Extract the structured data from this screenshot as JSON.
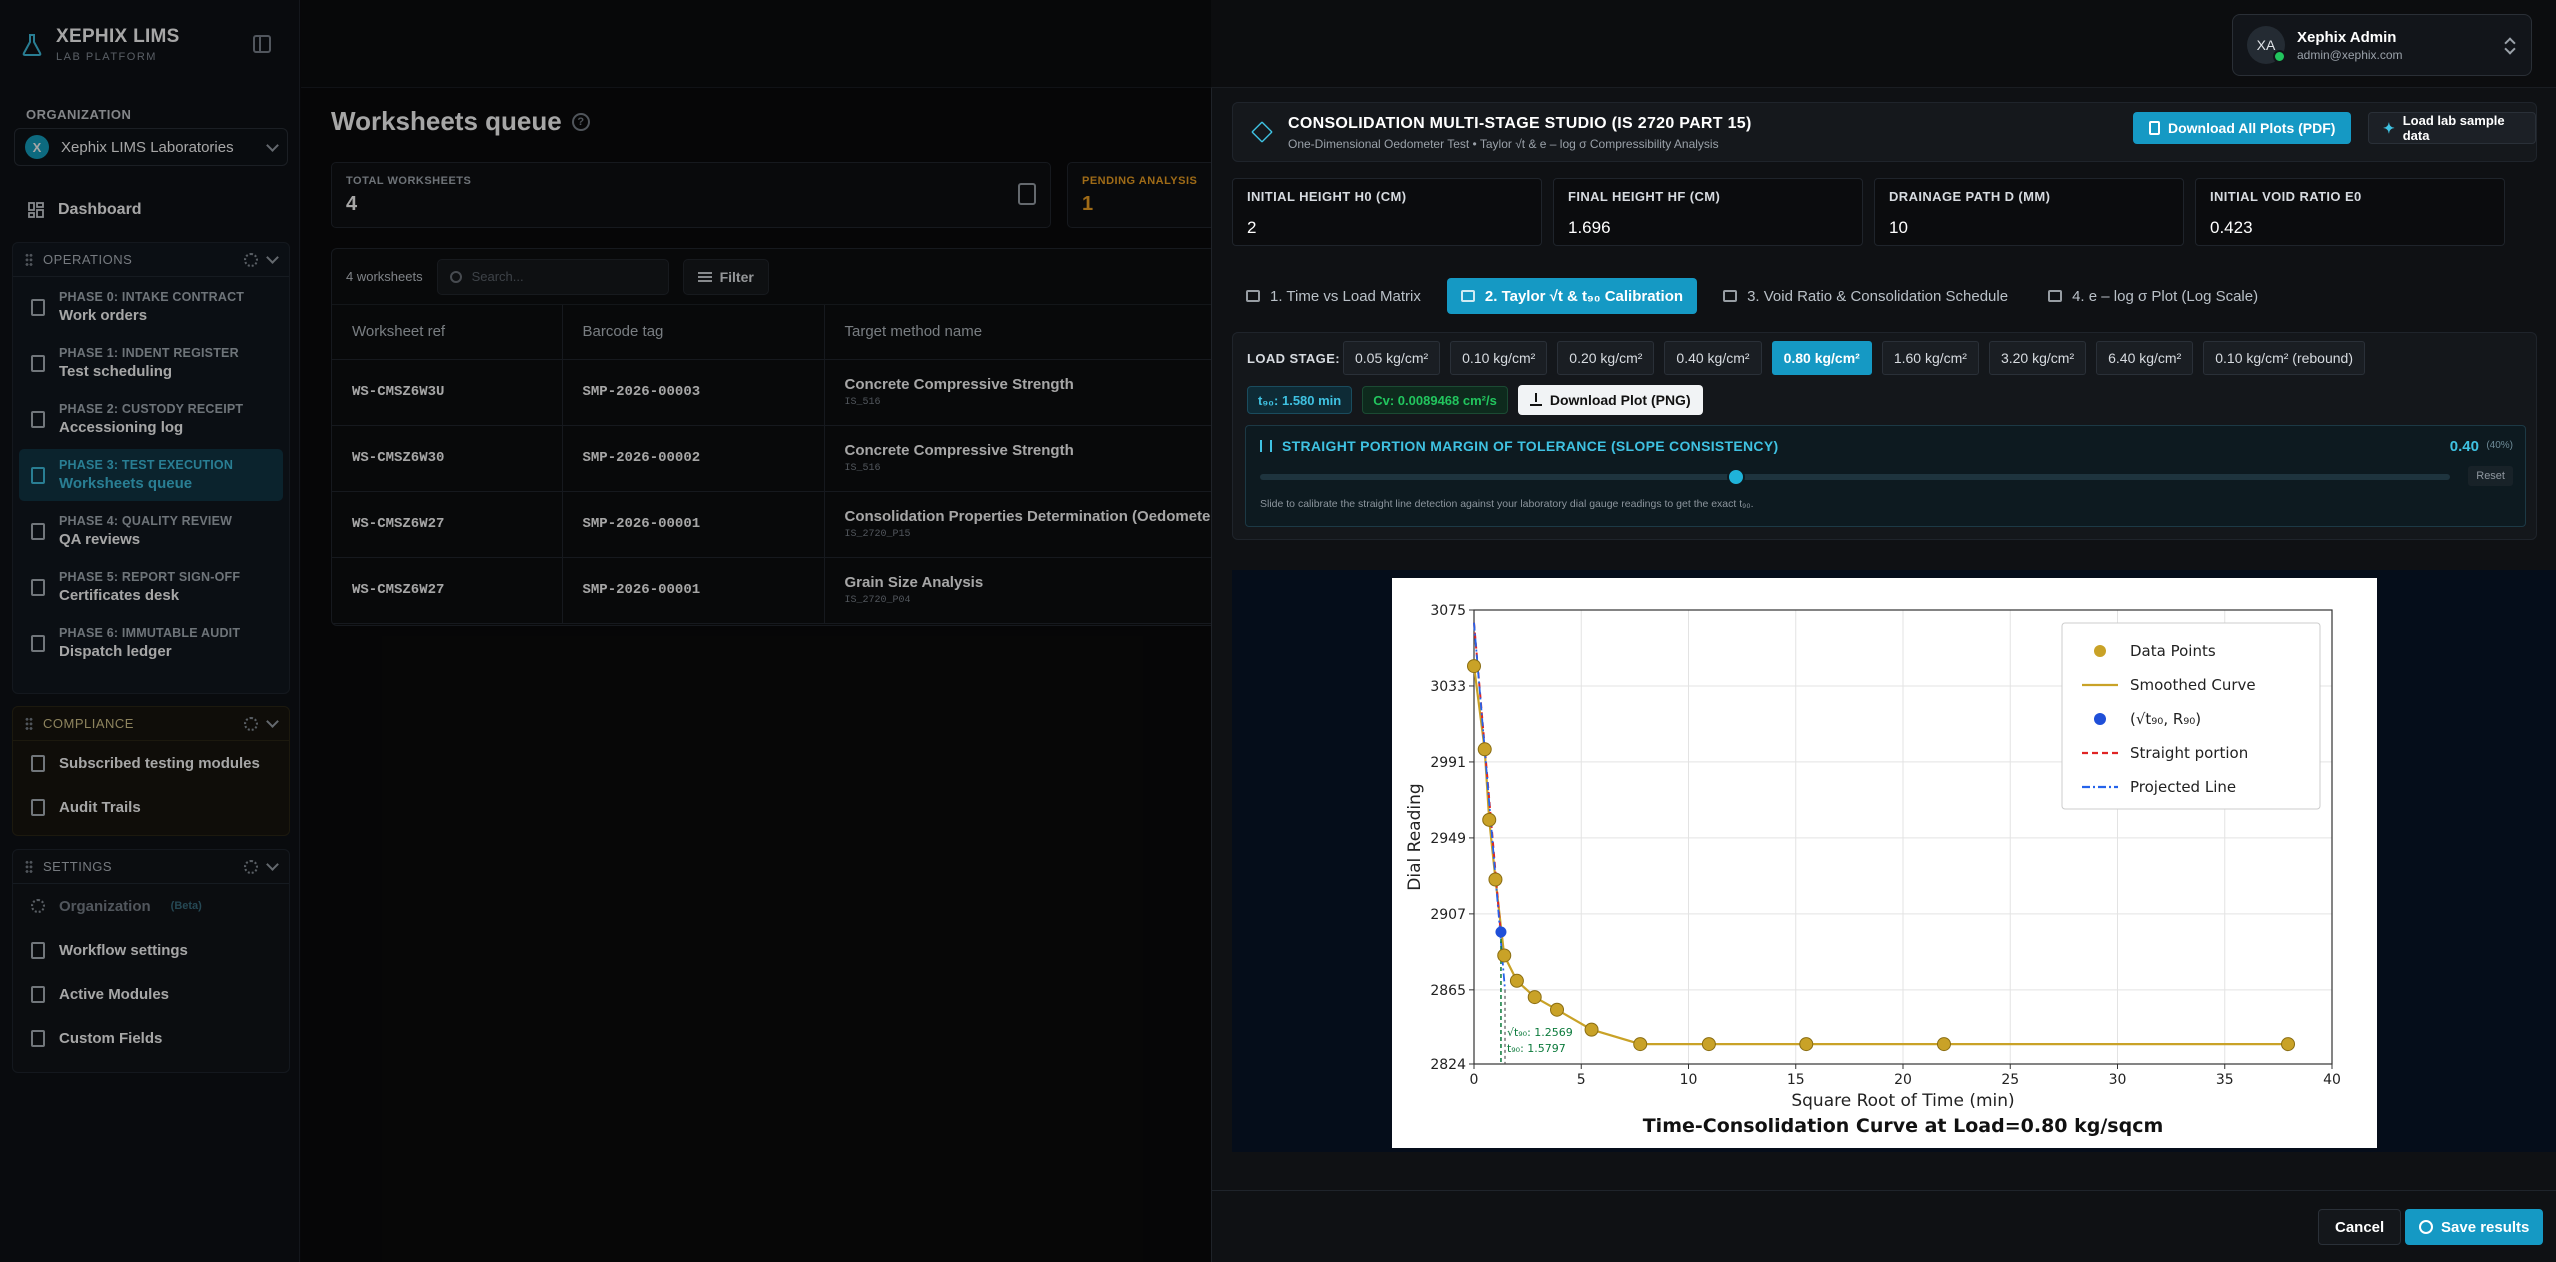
{
  "brand": {
    "title": "XEPHIX LIMS",
    "subtitle": "LAB PLATFORM"
  },
  "org": {
    "label": "ORGANIZATION",
    "badge": "X",
    "name": "Xephix LIMS Laboratories"
  },
  "nav": {
    "dashboard": "Dashboard",
    "operations": {
      "title": "OPERATIONS",
      "phases": [
        {
          "t1": "PHASE 0: INTAKE CONTRACT",
          "t2": "Work orders"
        },
        {
          "t1": "PHASE 1: INDENT REGISTER",
          "t2": "Test scheduling"
        },
        {
          "t1": "PHASE 2: CUSTODY RECEIPT",
          "t2": "Accessioning log"
        },
        {
          "t1": "PHASE 3: TEST EXECUTION",
          "t2": "Worksheets queue"
        },
        {
          "t1": "PHASE 4: QUALITY REVIEW",
          "t2": "QA reviews"
        },
        {
          "t1": "PHASE 5: REPORT SIGN-OFF",
          "t2": "Certificates desk"
        },
        {
          "t1": "PHASE 6: IMMUTABLE AUDIT",
          "t2": "Dispatch ledger"
        }
      ]
    },
    "compliance": {
      "title": "COMPLIANCE",
      "items": [
        "Subscribed testing modules",
        "Audit Trails"
      ]
    },
    "settings": {
      "title": "SETTINGS",
      "items": [
        "Organization",
        "Workflow settings",
        "Active Modules",
        "Custom Fields"
      ],
      "beta": "(Beta)"
    }
  },
  "user": {
    "initials": "XA",
    "name": "Xephix Admin",
    "email": "admin@xephix.com"
  },
  "page": {
    "title": "Worksheets queue",
    "help": "?"
  },
  "stats": [
    {
      "label": "TOTAL WORKSHEETS",
      "value": "4"
    },
    {
      "label": "PENDING ANALYSIS",
      "value": "1"
    }
  ],
  "table": {
    "count": "4 worksheets",
    "search_placeholder": "Search...",
    "filter": "Filter",
    "headers": [
      "Worksheet ref",
      "Barcode tag",
      "Target method name"
    ],
    "rows": [
      {
        "ref": "WS-CMSZ6W3U",
        "barcode": "SMP-2026-00003",
        "method": "Concrete Compressive Strength",
        "code": "IS_516"
      },
      {
        "ref": "WS-CMSZ6W30",
        "barcode": "SMP-2026-00002",
        "method": "Concrete Compressive Strength",
        "code": "IS_516"
      },
      {
        "ref": "WS-CMSZ6W27",
        "barcode": "SMP-2026-00001",
        "method": "Consolidation Properties Determination (Oedometer",
        "code": "IS_2720_P15"
      },
      {
        "ref": "WS-CMSZ6W27",
        "barcode": "SMP-2026-00001",
        "method": "Grain Size Analysis",
        "code": "IS_2720_P04"
      }
    ]
  },
  "studio": {
    "title": "CONSOLIDATION MULTI-STAGE STUDIO (IS 2720 PART 15)",
    "subtitle": "One-Dimensional Oedometer Test • Taylor √t & e – log σ Compressibility Analysis",
    "download_all": "Download All Plots (PDF)",
    "load_sample": "Load lab sample data",
    "inputs": [
      {
        "label": "INITIAL HEIGHT H0 (CM)",
        "value": "2"
      },
      {
        "label": "FINAL HEIGHT HF (CM)",
        "value": "1.696"
      },
      {
        "label": "DRAINAGE PATH D (MM)",
        "value": "10"
      },
      {
        "label": "INITIAL VOID RATIO E0",
        "value": "0.423"
      }
    ],
    "tabs": [
      "1. Time vs Load Matrix",
      "2. Taylor √t & t₉₀ Calibration",
      "3. Void Ratio & Consolidation Schedule",
      "4. e – log σ Plot (Log Scale)"
    ],
    "load_stage_label": "LOAD STAGE:",
    "load_stages": [
      "0.05 kg/cm²",
      "0.10 kg/cm²",
      "0.20 kg/cm²",
      "0.40 kg/cm²",
      "0.80 kg/cm²",
      "1.60 kg/cm²",
      "3.20 kg/cm²",
      "6.40 kg/cm²",
      "0.10 kg/cm² (rebound)"
    ],
    "t90": "t₉₀: 1.580 min",
    "cv": "Cv: 0.0089468 cm²/s",
    "download_png": "Download Plot (PNG)",
    "tolerance": {
      "title": "STRAIGHT PORTION MARGIN OF TOLERANCE (SLOPE CONSISTENCY)",
      "value": "0.40",
      "pct": "(40%)",
      "reset": "Reset",
      "level": 0.4,
      "help": "Slide to calibrate the straight line detection against your laboratory dial gauge readings to get the exact t₉₀."
    },
    "cancel": "Cancel",
    "save": "Save results"
  },
  "chart_data": {
    "type": "line",
    "title": "Time-Consolidation Curve at Load=0.80 kg/sqcm",
    "xlabel": "Square Root of Time (min)",
    "ylabel": "Dial Reading",
    "xlim": [
      0,
      40
    ],
    "ylim": [
      2824,
      3075
    ],
    "xticks": [
      0,
      5,
      10,
      15,
      20,
      25,
      30,
      35,
      40
    ],
    "yticks": [
      2824,
      2865,
      2907,
      2949,
      2991,
      3033,
      3075
    ],
    "grid": true,
    "legend": "top-right",
    "series": [
      {
        "name": "Data Points",
        "x": [
          0,
          0.5,
          0.71,
          1.0,
          1.41,
          2.0,
          2.83,
          3.87,
          5.48,
          7.75,
          10.95,
          15.49,
          21.91,
          37.95
        ],
        "y": [
          3044,
          2998,
          2959,
          2926,
          2884,
          2870,
          2861,
          2854,
          2843,
          2835,
          2835,
          2835,
          2835,
          2835
        ]
      },
      {
        "name": "Smoothed Curve"
      },
      {
        "name": "(√t₉₀, R₉₀)",
        "x": [
          1.2569
        ],
        "y": [
          2897
        ]
      },
      {
        "name": "Straight portion",
        "x": [
          0,
          1.2569
        ],
        "y": [
          3068,
          2895
        ]
      },
      {
        "name": "Projected Line",
        "x": [
          0,
          1.4455
        ],
        "y": [
          3068,
          2865
        ]
      }
    ],
    "annotations": [
      "√t₉₀: 1.2569",
      "t₉₀: 1.5797"
    ],
    "colors": {
      "points": "#c9a227",
      "curve": "#c9a227",
      "t90point": "#1f4fd8",
      "straight": "#e02424",
      "projected": "#2563eb",
      "marker": "#0b7a3b"
    }
  }
}
